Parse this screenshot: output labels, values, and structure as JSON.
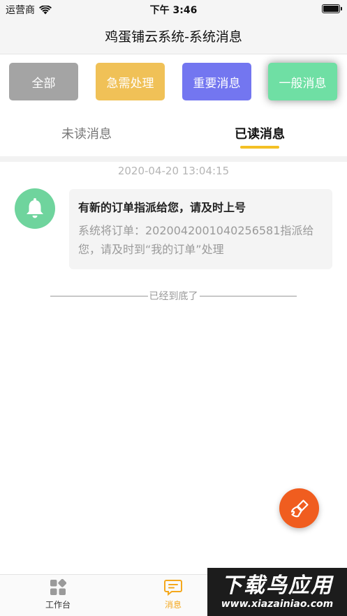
{
  "status_bar": {
    "carrier": "运营商",
    "time": "下午 3:46"
  },
  "nav": {
    "title": "鸡蛋铺云系统-系统消息"
  },
  "filters": [
    {
      "label": "全部",
      "color": "#a4a4a4"
    },
    {
      "label": "急需处理",
      "color": "#f0c157"
    },
    {
      "label": "重要消息",
      "color": "#7376f0"
    },
    {
      "label": "一般消息",
      "color": "#6fdfa4",
      "active": true
    }
  ],
  "tabs": [
    {
      "label": "未读消息",
      "active": false
    },
    {
      "label": "已读消息",
      "active": true
    }
  ],
  "accent_color": "#f4c024",
  "messages": [
    {
      "timestamp": "2020-04-20 13:04:15",
      "icon": "bell-icon",
      "title": "有新的订单指派给您，请及时上号",
      "body": "系统将订单：2020042001040256581指派给您，请及时到“我的订单”处理"
    }
  ],
  "list_end": "已经到底了",
  "fab": {
    "icon": "broom-icon",
    "color": "#f05d1f"
  },
  "tabbar": [
    {
      "label": "工作台",
      "icon": "grid-icon",
      "active": false
    },
    {
      "label": "消息",
      "icon": "message-icon",
      "active": true
    }
  ],
  "watermark": {
    "main": "下载鸟应用",
    "url": "www.xiazainiao.com"
  }
}
